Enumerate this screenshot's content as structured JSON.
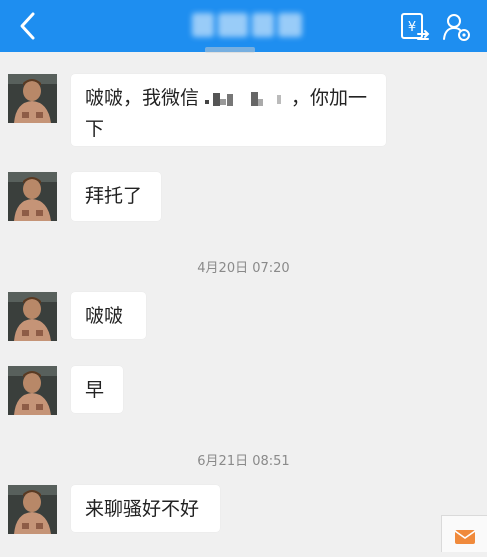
{
  "header": {
    "back_icon": "chevron-left-icon",
    "title_redacted": true,
    "actions": [
      {
        "icon": "yuan-transfer-icon"
      },
      {
        "icon": "user-settings-icon"
      }
    ],
    "bg_color": "#1e8ef0"
  },
  "messages": [
    {
      "kind": "text",
      "text_before": "啵啵，我微信",
      "redacted": true,
      "text_after": "，你加一下"
    },
    {
      "kind": "text",
      "text": "拜托了"
    },
    {
      "kind": "timestamp",
      "text": "4月20日 07:20"
    },
    {
      "kind": "text",
      "text": "啵啵"
    },
    {
      "kind": "text",
      "text": "早"
    },
    {
      "kind": "timestamp",
      "text": "6月21日 08:51"
    },
    {
      "kind": "text",
      "text": "来聊骚好不好"
    }
  ],
  "floating": {
    "icon": "mail-icon",
    "color": "#f08a3c"
  }
}
